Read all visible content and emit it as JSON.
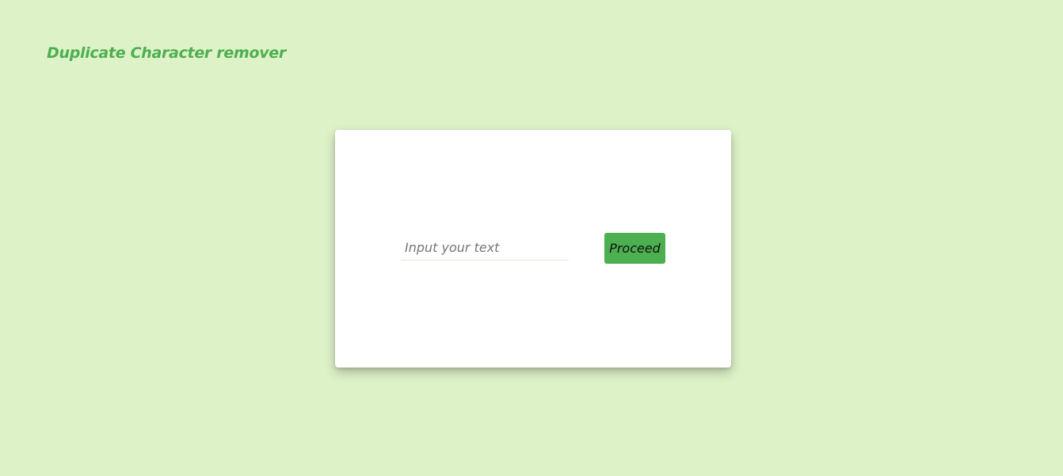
{
  "header": {
    "title": "Duplicate Character remover"
  },
  "form": {
    "input_value": "",
    "input_placeholder": "Input your text",
    "proceed_label": "Proceed"
  },
  "colors": {
    "background": "#def2c8",
    "accent": "#4caf50",
    "card": "#ffffff"
  }
}
